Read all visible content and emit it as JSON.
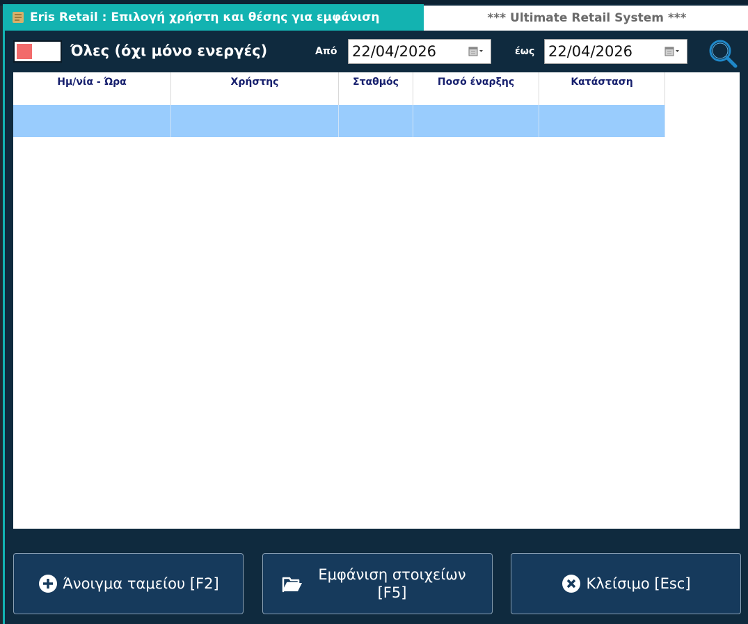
{
  "window": {
    "title": "Eris Retail : Επιλογή χρήστη και θέσης για εμφάνιση",
    "system_title": "*** Ultimate Retail System ***"
  },
  "filters": {
    "all_label": "Όλες (όχι μόνο ενεργές)",
    "from_label": "Από",
    "from_date": "22/04/2026",
    "to_label": "έως",
    "to_date": "22/04/2026"
  },
  "grid": {
    "columns": [
      "Ημ/νία - Ώρα",
      "Χρήστης",
      "Σταθμός",
      "Ποσό έναρξης",
      "Κατάσταση"
    ],
    "rows": [
      [
        "",
        "",
        "",
        "",
        ""
      ]
    ]
  },
  "buttons": {
    "open_label": "Άνοιγμα ταμείου [F2]",
    "show_label_line1": "Εμφάνιση στοιχείων",
    "show_label_line2": "[F5]",
    "close_label": "Κλείσιμο [Esc]"
  },
  "colors": {
    "title_bar": "#13b3b1",
    "background": "#0f2a3e",
    "button": "#163a5c",
    "selected_row": "#99ccfd",
    "header_text": "#17206e",
    "toggle_off": "#f26b6b"
  },
  "icons": {
    "title": "app-scroll-icon",
    "calendar": "calendar-icon",
    "search": "search-icon",
    "open": "plus-circle-icon",
    "show": "folder-open-icon",
    "close": "close-circle-icon"
  }
}
